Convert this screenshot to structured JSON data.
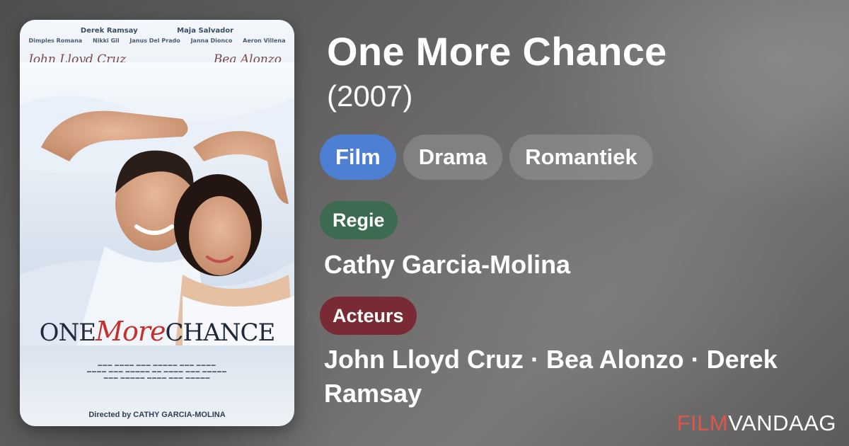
{
  "poster": {
    "cast_top_row": [
      "Derek Ramsay",
      "Maja Salvador"
    ],
    "cast_second_row": [
      "Dimples Romana",
      "Nikki Gil",
      "Janus Del Prado",
      "Janna Dionco",
      "Aeron Villena"
    ],
    "signature_left": "John Lloyd Cruz",
    "signature_right": "Bea Alonzo",
    "title_one": "ONE",
    "title_more": "More",
    "title_chance": "CHANCE",
    "director_credit": "Directed by CATHY GARCIA-MOLINA"
  },
  "movie": {
    "title": "One More Chance",
    "year": "(2007)"
  },
  "chips": [
    {
      "label": "Film",
      "active": true
    },
    {
      "label": "Drama",
      "active": false
    },
    {
      "label": "Romantiek",
      "active": false
    }
  ],
  "regie": {
    "label": "Regie",
    "value": "Cathy Garcia-Molina"
  },
  "acteurs": {
    "label": "Acteurs",
    "value": "John Lloyd Cruz · Bea Alonzo · Derek Ramsay"
  },
  "brand": {
    "part1": "FILM",
    "part2": "VANDAAG",
    "color_film": "#e0554b",
    "color_vandaag": "#ffffff"
  },
  "colors": {
    "chip_active": "#4d7fd2",
    "regie_badge": "#3c6b51",
    "acteurs_badge": "#7a2a34"
  }
}
